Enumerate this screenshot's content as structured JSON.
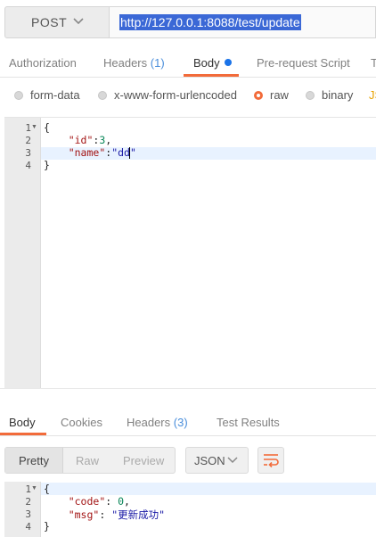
{
  "request": {
    "method": "POST",
    "url": "http://127.0.0.1:8088/test/update"
  },
  "request_tabs": [
    {
      "label": "Authorization"
    },
    {
      "label": "Headers",
      "count": "(1)"
    },
    {
      "label": "Body",
      "active": true
    },
    {
      "label": "Pre-request Script"
    },
    {
      "label": "T"
    }
  ],
  "body_types": [
    {
      "label": "form-data",
      "selected": false
    },
    {
      "label": "x-www-form-urlencoded",
      "selected": false
    },
    {
      "label": "raw",
      "selected": true
    },
    {
      "label": "binary",
      "selected": false
    }
  ],
  "body_format_link": "JS",
  "request_body": {
    "line_numbers": [
      "1",
      "2",
      "3",
      "4"
    ],
    "lines": [
      {
        "text": "{"
      },
      {
        "key": "\"id\"",
        "sep": ":",
        "value": "3",
        "tail": ","
      },
      {
        "key": "\"name\"",
        "sep": ":",
        "value": "\"dd\"",
        "tail": ""
      },
      {
        "text": "}"
      }
    ]
  },
  "response_tabs": [
    {
      "label": "Body",
      "active": true
    },
    {
      "label": "Cookies"
    },
    {
      "label": "Headers",
      "count": "(3)"
    },
    {
      "label": "Test Results"
    }
  ],
  "response_view": {
    "modes": [
      "Pretty",
      "Raw",
      "Preview"
    ],
    "selected_mode": "Pretty",
    "format": "JSON"
  },
  "response_body": {
    "line_numbers": [
      "1",
      "2",
      "3",
      "4"
    ],
    "lines": [
      {
        "text": "{"
      },
      {
        "key": "\"code\"",
        "sep": ": ",
        "value": "0",
        "tail": ","
      },
      {
        "key": "\"msg\"",
        "sep": ": ",
        "value": "\"更新成功\"",
        "tail": ""
      },
      {
        "text": "}"
      }
    ]
  },
  "colors": {
    "accent": "#f26b3a",
    "selection": "#3b68d6",
    "active_line": "#e8f2ff"
  }
}
